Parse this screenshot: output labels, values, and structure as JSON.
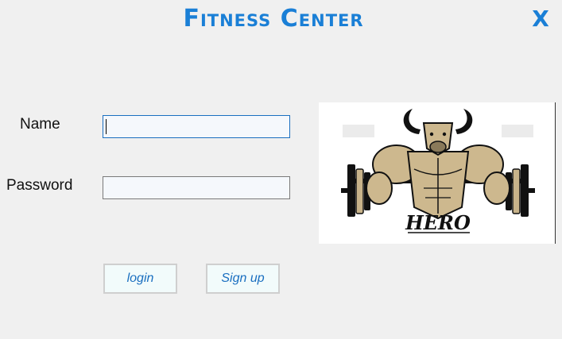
{
  "window": {
    "title": "Fitness Center",
    "close_label": "X"
  },
  "form": {
    "name_label": "Name",
    "name_value": "",
    "password_label": "Password",
    "password_value": ""
  },
  "buttons": {
    "login_label": "login",
    "signup_label": "Sign up"
  },
  "logo": {
    "text": "HERO",
    "icon": "bull-bodybuilder-barbell-icon"
  },
  "colors": {
    "accent": "#1a7fd6",
    "button_text": "#1a6fc0",
    "background": "#f0f0f0"
  }
}
